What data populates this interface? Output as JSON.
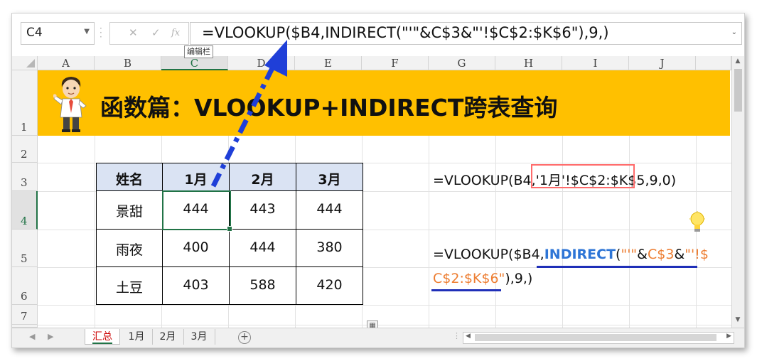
{
  "formula_bar": {
    "name_box": "C4",
    "cancel_symbol": "✕",
    "enter_symbol": "✓",
    "fx_symbol": "fx",
    "formula": "=VLOOKUP($B4,INDIRECT(\"'\"&C$3&\"'!$C$2:$K$6\"),9,)",
    "tooltip": "编辑栏"
  },
  "columns": [
    "A",
    "B",
    "C",
    "D",
    "E",
    "F",
    "G",
    "H",
    "I",
    "J"
  ],
  "rows": [
    "1",
    "2",
    "3",
    "4",
    "5",
    "6",
    "7"
  ],
  "banner": {
    "title": "函数篇：VLOOKUP+INDIRECT跨表查询",
    "color": "#ffc000"
  },
  "table": {
    "headers": [
      "姓名",
      "1月",
      "2月",
      "3月"
    ],
    "rows": [
      {
        "name": "景甜",
        "m1": "444",
        "m2": "443",
        "m3": "444"
      },
      {
        "name": "雨夜",
        "m1": "400",
        "m2": "444",
        "m3": "380"
      },
      {
        "name": "土豆",
        "m1": "403",
        "m2": "588",
        "m3": "420"
      }
    ],
    "header_bg": "#dae3f3"
  },
  "annotations": {
    "simple_formula_prefix": "=VLOOKUP(B4,",
    "simple_formula_ref": "'1月'!$C$2:$K$5",
    "simple_formula_suffix": ",9,0)",
    "indirect_prefix": "=VLOOKUP($B4,",
    "indirect_func": "INDIRECT",
    "indirect_open": "(",
    "indirect_quote": "\"'\"",
    "indirect_amp": "&",
    "indirect_c3": "C$3",
    "indirect_amp2": "&",
    "indirect_str1": "\"'!$",
    "indirect_str2": "C$2:$K$6\"",
    "indirect_suffix": "),9,)"
  },
  "sheet_tabs": [
    "汇总",
    "1月",
    "2月",
    "3月"
  ],
  "active_tab": "汇总",
  "colors": {
    "excel_green": "#217346",
    "arrow_blue": "#1f3fd8",
    "accent_orange": "#ed7d31"
  }
}
